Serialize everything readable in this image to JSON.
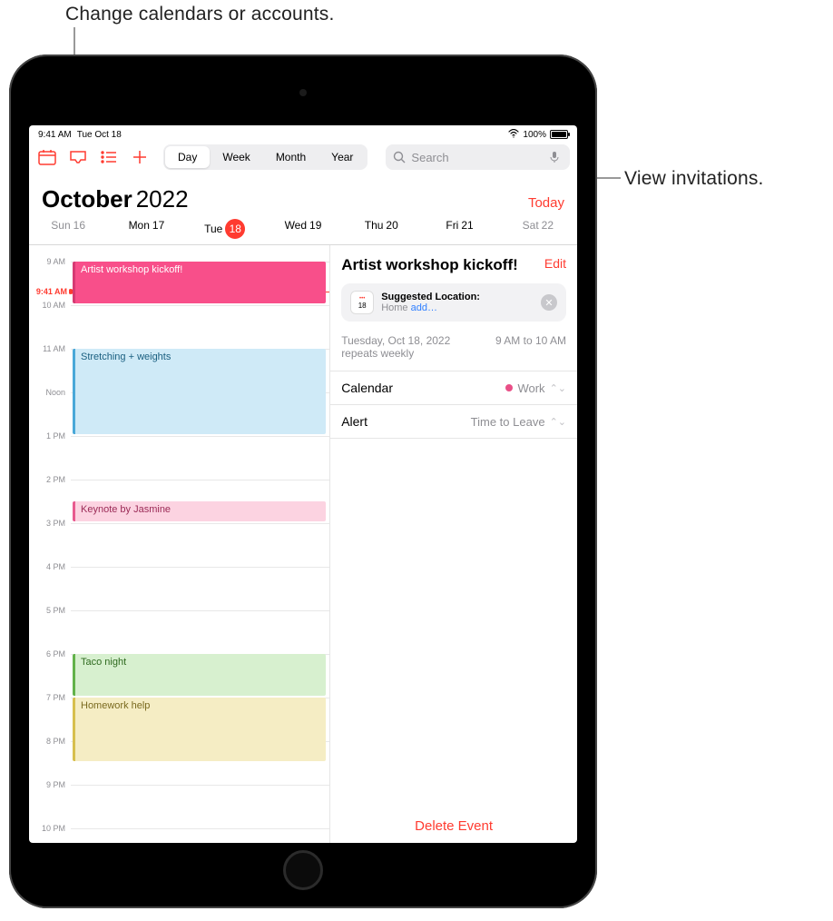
{
  "callouts": {
    "top": "Change calendars or accounts.",
    "right": "View invitations."
  },
  "status": {
    "time": "9:41 AM",
    "date": "Tue Oct 18",
    "battery": "100%"
  },
  "toolbar": {
    "views": [
      "Day",
      "Week",
      "Month",
      "Year"
    ],
    "active_view": "Day",
    "search_placeholder": "Search"
  },
  "header": {
    "month": "October",
    "year": "2022",
    "today_label": "Today"
  },
  "weekdays": [
    {
      "label": "Sun",
      "num": "16",
      "dim": true
    },
    {
      "label": "Mon",
      "num": "17"
    },
    {
      "label": "Tue",
      "num": "18",
      "today": true
    },
    {
      "label": "Wed",
      "num": "19"
    },
    {
      "label": "Thu",
      "num": "20"
    },
    {
      "label": "Fri",
      "num": "21"
    },
    {
      "label": "Sat",
      "num": "22",
      "dim": true
    }
  ],
  "timeline": {
    "hours": [
      "9 AM",
      "10 AM",
      "11 AM",
      "Noon",
      "1 PM",
      "2 PM",
      "3 PM",
      "4 PM",
      "5 PM",
      "6 PM",
      "7 PM",
      "8 PM",
      "9 PM",
      "10 PM"
    ],
    "now_label": "9:41 AM",
    "events": [
      {
        "title": "Artist workshop kickoff!",
        "start": "9 AM",
        "end": "10 AM",
        "color": "pink"
      },
      {
        "title": "Stretching + weights",
        "start": "11 AM",
        "end": "1 PM",
        "color": "blue"
      },
      {
        "title": "Keynote by Jasmine",
        "start": "2:30 PM",
        "end": "3 PM",
        "color": "lpink"
      },
      {
        "title": "Taco night",
        "start": "6 PM",
        "end": "7 PM",
        "color": "green"
      },
      {
        "title": "Homework help",
        "start": "7 PM",
        "end": "8:30 PM",
        "color": "yellow"
      }
    ]
  },
  "details": {
    "title": "Artist workshop kickoff!",
    "edit": "Edit",
    "suggested": {
      "day": "18",
      "heading": "Suggested Location:",
      "line": "Home ",
      "link": "add…"
    },
    "date": "Tuesday, Oct 18, 2022",
    "repeat": "repeats weekly",
    "time": "9 AM to 10 AM",
    "rows": [
      {
        "label": "Calendar",
        "value": "Work",
        "dot": true
      },
      {
        "label": "Alert",
        "value": "Time to Leave"
      }
    ],
    "delete": "Delete Event"
  }
}
